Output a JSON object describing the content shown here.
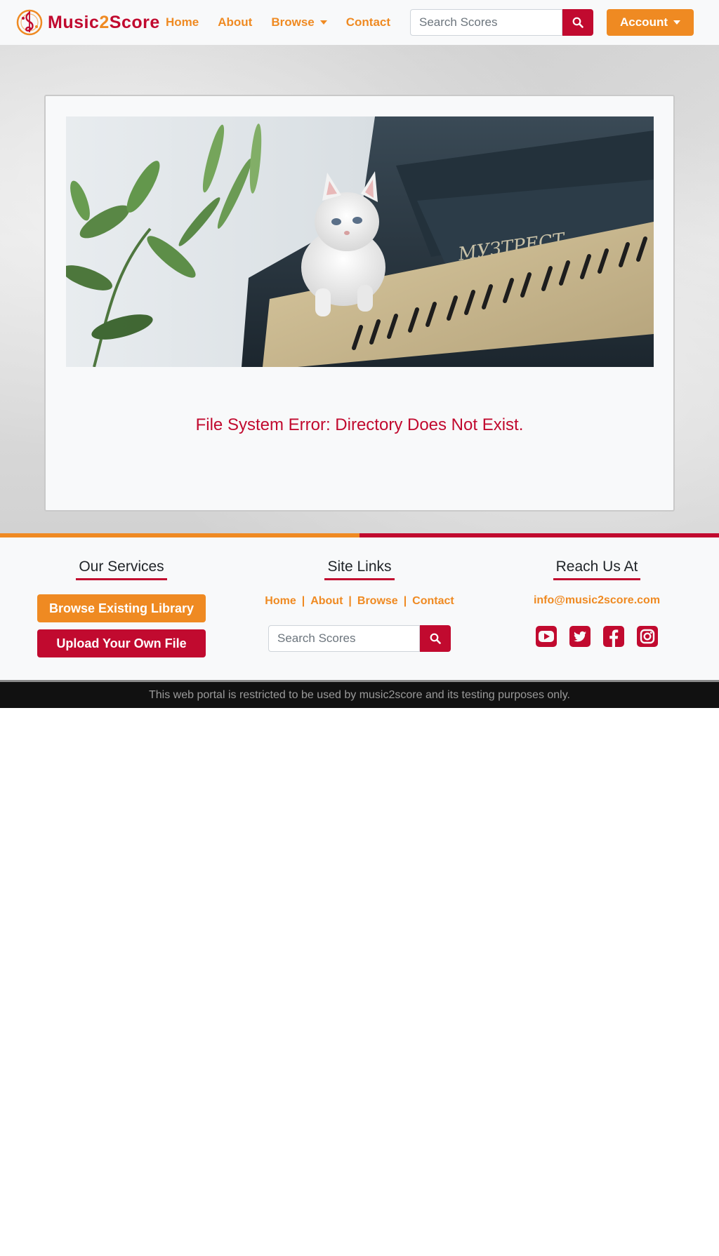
{
  "brand": {
    "name_part1": "Music",
    "name_part2": "2",
    "name_part3": "Score"
  },
  "nav": {
    "items": [
      {
        "label": "Home"
      },
      {
        "label": "About"
      },
      {
        "label": "Browse"
      },
      {
        "label": "Contact"
      }
    ]
  },
  "search": {
    "placeholder": "Search Scores"
  },
  "account": {
    "label": "Account"
  },
  "main": {
    "error_message": "File System Error: Directory Does Not Exist."
  },
  "footer": {
    "services": {
      "heading": "Our Services",
      "browse_label": "Browse Existing Library",
      "upload_label": "Upload Your Own File"
    },
    "site_links": {
      "heading": "Site Links",
      "links": [
        "Home",
        "About",
        "Browse",
        "Contact"
      ],
      "separator": "|"
    },
    "reach": {
      "heading": "Reach Us At",
      "email": "info@music2score.com",
      "socials": [
        "youtube-icon",
        "twitter-icon",
        "facebook-icon",
        "instagram-icon"
      ]
    },
    "disclaimer": "This web portal is restricted to be used by music2score and its testing purposes only."
  },
  "colors": {
    "accent_orange": "#ef8a22",
    "accent_red": "#c10a2f",
    "background_light": "#f8f9fa",
    "bottom_bar": "#111111"
  }
}
